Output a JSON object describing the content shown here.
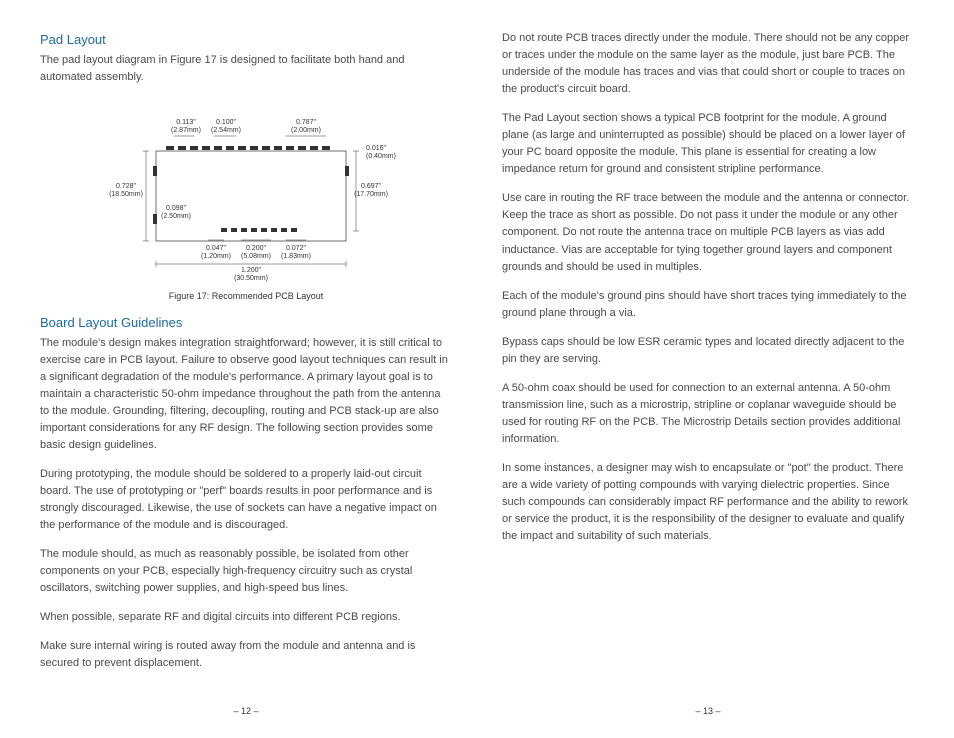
{
  "left": {
    "heading1": "Pad Layout",
    "p1": "The pad layout diagram in Figure 17 is designed to facilitate both hand and automated assembly.",
    "dimensions": {
      "d1_in": "0.113\"",
      "d1_mm": "(2.87mm)",
      "d2_in": "0.100\"",
      "d2_mm": "(2.54mm)",
      "d3_in": "0.787\"",
      "d3_mm": "(2.00mm)",
      "d4_in": "0.016\"",
      "d4_mm": "(0.40mm)",
      "d5_in": "0.728\"",
      "d5_mm": "(18.50mm)",
      "d6_in": "0.098\"",
      "d6_mm": "(2.50mm)",
      "d7_in": "0.697\"",
      "d7_mm": "(17.70mm)",
      "d8_in": "0.047\"",
      "d8_mm": "(1.20mm)",
      "d9_in": "0.200\"",
      "d9_mm": "(5.08mm)",
      "d10_in": "0.072\"",
      "d10_mm": "(1.83mm)",
      "d11_in": "1.200\"",
      "d11_mm": "(30.50mm)"
    },
    "figcap": "Figure 17: Recommended PCB Layout",
    "heading2": "Board Layout Guidelines",
    "p2": "The module's design makes integration straightforward; however, it is still critical to exercise care in PCB layout. Failure to observe good layout techniques can result in a significant degradation of the module's performance. A primary layout goal is to maintain a characteristic 50-ohm impedance throughout the path from the antenna to the module. Grounding, filtering, decoupling, routing and PCB stack-up are also important considerations for any RF design. The following section provides some basic design guidelines.",
    "p3": "During prototyping, the module should be soldered to a properly laid-out circuit board. The use of prototyping or \"perf\" boards results in poor performance and is strongly discouraged. Likewise, the use of sockets can have a negative impact on the performance of the module and is discouraged.",
    "p4": "The module should, as much as reasonably possible, be isolated from other components on your PCB, especially high-frequency circuitry such as crystal oscillators, switching power supplies, and high-speed bus lines.",
    "p5": "When possible, separate RF and digital circuits into different PCB regions.",
    "p6": "Make sure internal wiring is routed away from the module and antenna and is secured to prevent displacement.",
    "pagenum": "– 12 –"
  },
  "right": {
    "p1": "Do not route PCB traces directly under the module. There should not be any copper or traces under the module on the same layer as the module, just bare PCB. The underside of the module has traces and vias that could short or couple to traces on the product's circuit board.",
    "p2": "The Pad Layout section shows a typical PCB footprint for the module. A ground plane (as large and uninterrupted as possible) should be placed on a lower layer of your PC board opposite the module. This plane is essential for creating a low impedance return for ground and consistent stripline performance.",
    "p3": "Use care in routing the RF trace between the module and the antenna or connector. Keep the trace as short as possible. Do not pass it under the module or any other component. Do not route the antenna trace on multiple PCB layers as vias add inductance. Vias are acceptable for tying together ground layers and component grounds and should be used in multiples.",
    "p4": "Each of the module's ground pins should have short traces tying immediately to the ground plane through a via.",
    "p5": "Bypass caps should be low ESR ceramic types and located directly adjacent to the pin they are serving.",
    "p6": "A 50-ohm coax should be used for connection to an external antenna. A 50-ohm transmission line, such as a microstrip, stripline or coplanar waveguide should be used for routing RF on the PCB. The Microstrip Details section provides additional information.",
    "p7": "In some instances, a designer may wish to encapsulate or \"pot\" the product. There are a wide variety of potting compounds with varying dielectric properties. Since such compounds can considerably impact RF performance and the ability to rework or service the product, it is the responsibility of the designer to evaluate and qualify the impact and suitability of such materials.",
    "pagenum": "– 13 –"
  }
}
